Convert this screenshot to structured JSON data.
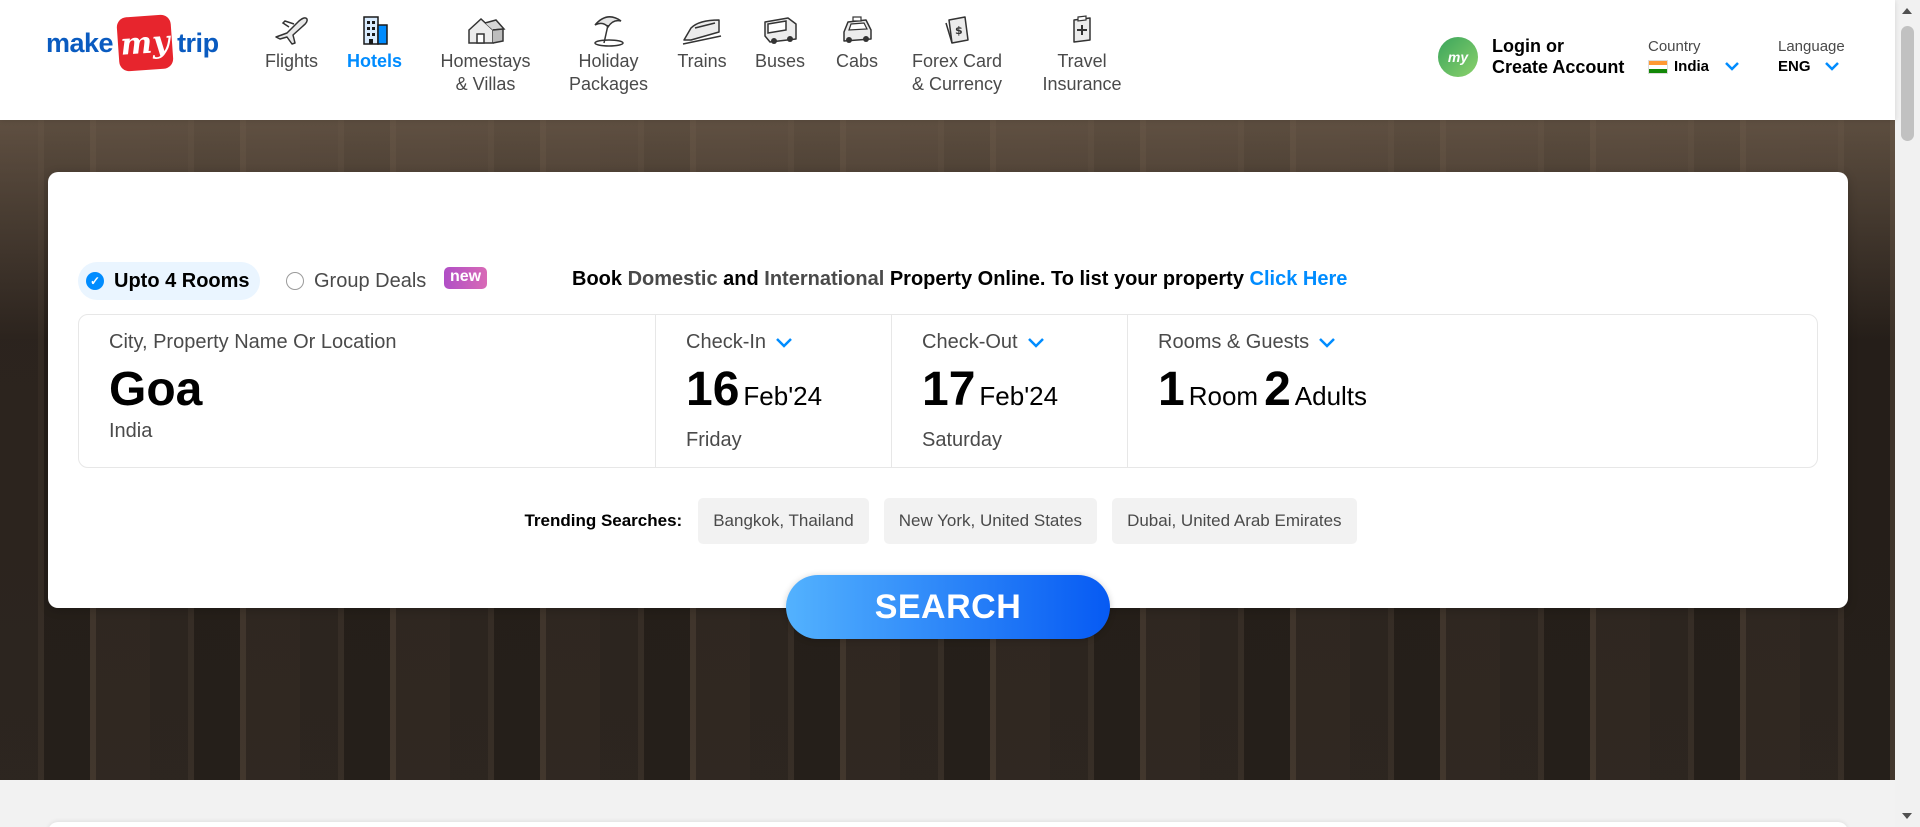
{
  "brand": {
    "make": "make",
    "my": "my",
    "trip": "trip"
  },
  "nav": [
    {
      "label": "Flights",
      "icon": "plane-icon"
    },
    {
      "label": "Hotels",
      "icon": "hotel-icon",
      "active": true
    },
    {
      "label": "Homestays\n& Villas",
      "icon": "homestay-icon"
    },
    {
      "label": "Holiday\nPackages",
      "icon": "umbrella-icon"
    },
    {
      "label": "Trains",
      "icon": "train-icon"
    },
    {
      "label": "Buses",
      "icon": "bus-icon"
    },
    {
      "label": "Cabs",
      "icon": "cab-icon"
    },
    {
      "label": "Forex Card\n& Currency",
      "icon": "forex-icon"
    },
    {
      "label": "Travel\nInsurance",
      "icon": "insurance-icon"
    }
  ],
  "login": {
    "avatar_text": "my",
    "line1": "Login or",
    "line2": "Create Account"
  },
  "country": {
    "caption": "Country",
    "value": "India"
  },
  "language": {
    "caption": "Language",
    "value": "ENG"
  },
  "room_options": {
    "opt1": "Upto 4 Rooms",
    "opt2": "Group Deals",
    "new_badge": "new"
  },
  "promo": {
    "p1": "Book ",
    "domestic": "Domestic",
    "p2": " and ",
    "international": "International",
    "p3": " Property Online. To list your property ",
    "link": "Click Here"
  },
  "search": {
    "city_label": "City, Property Name Or Location",
    "city": "Goa",
    "country": "India",
    "checkin_label": "Check-In",
    "checkin_day": "16",
    "checkin_month": "Feb'24",
    "checkin_weekday": "Friday",
    "checkout_label": "Check-Out",
    "checkout_day": "17",
    "checkout_month": "Feb'24",
    "checkout_weekday": "Saturday",
    "guests_label": "Rooms & Guests",
    "rooms_count": "1",
    "rooms_text": "Room",
    "adults_count": "2",
    "adults_text": "Adults"
  },
  "trending": {
    "label": "Trending Searches:",
    "items": [
      "Bangkok, Thailand",
      "New York, United States",
      "Dubai, United Arab Emirates"
    ]
  },
  "search_button": "SEARCH",
  "colors": {
    "brand_blue": "#008cff",
    "logo_red": "#e7252d",
    "logo_blue": "#0a5bc0"
  }
}
